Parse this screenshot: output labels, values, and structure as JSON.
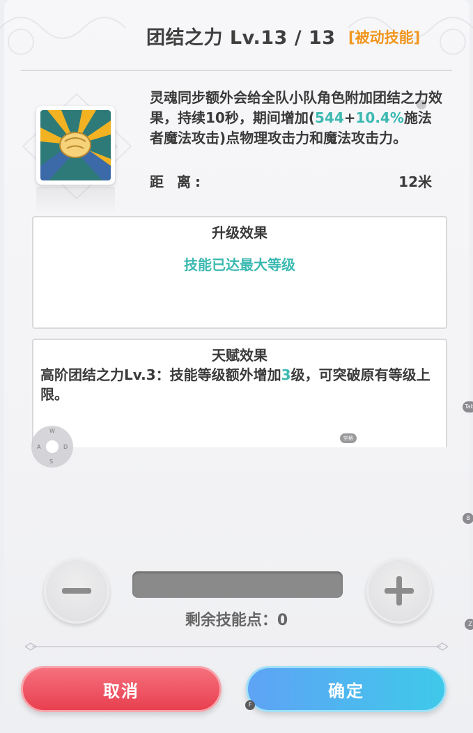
{
  "header": {
    "title": "团结之力 Lv.13 / 13",
    "tag": "[被动技能]"
  },
  "skill": {
    "icon": "arm-wrestle-handshake-icon",
    "description_parts": {
      "p1": "灵魂同步额外会给全队小队角色附加团结之力效果，持续10秒，期间增加(",
      "base": "544",
      "plus": "+",
      "ratio": "10.4%",
      "p2": "施法者魔法攻击)点物理攻击力和魔法攻击力。"
    },
    "range_label": "距 离:",
    "range_value": "12米"
  },
  "upgrade_box": {
    "title": "升级效果",
    "text": "技能已达最大等级"
  },
  "talent_box": {
    "title": "天赋效果",
    "text_prefix": "高阶团结之力Lv.3：技能等级额外增加",
    "level": "3",
    "text_suffix": "级，可突破原有等级上限。"
  },
  "stepper": {
    "remaining_label": "剩余技能点：",
    "remaining_value": "0"
  },
  "buttons": {
    "cancel": "取消",
    "confirm": "确定"
  },
  "hotkeys": {
    "joystick": {
      "up": "W",
      "left": "A",
      "right": "D",
      "down": "S"
    },
    "tab": "Tab",
    "b": "B",
    "z": "Z",
    "f": "F",
    "pill": "空格"
  },
  "colors": {
    "accent_teal": "#3bb9b1",
    "tag_orange": "#f0961e",
    "cancel_red": "#e8404f",
    "confirm_blue": "#4fb6f0"
  }
}
